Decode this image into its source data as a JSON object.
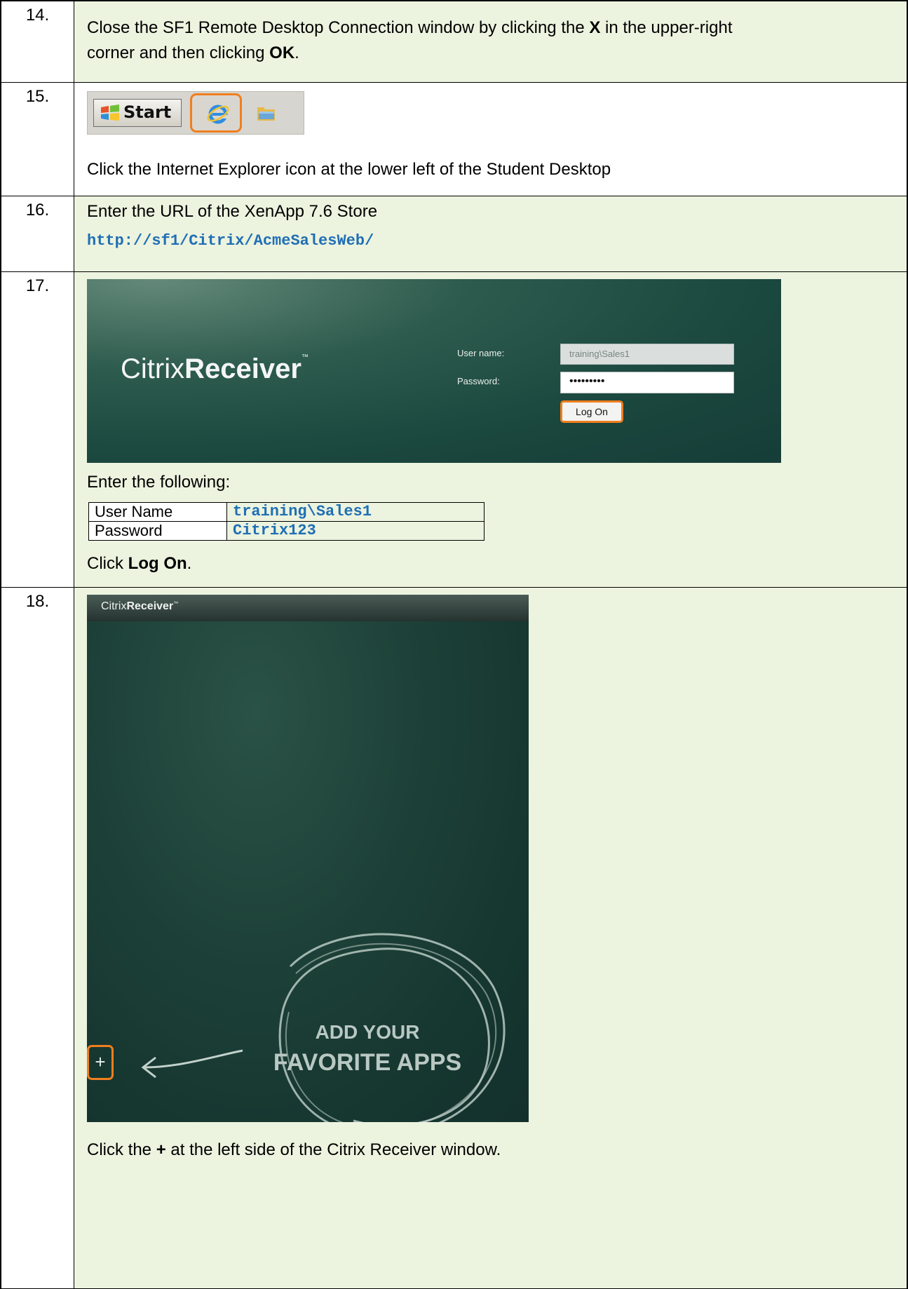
{
  "steps": [
    {
      "number": "14.",
      "text_parts": [
        "Close the SF1 Remote Desktop Connection window by clicking the ",
        "X",
        " in the upper-right",
        "corner and then clicking ",
        "OK",
        "."
      ]
    },
    {
      "number": "15.",
      "taskbar": {
        "start_label": "Start"
      },
      "text": "Click the Internet Explorer icon at the lower left of the Student Desktop"
    },
    {
      "number": "16.",
      "text": "Enter the URL of the XenApp 7.6 Store",
      "url": "http://sf1/Citrix/AcmeSalesWeb/"
    },
    {
      "number": "17.",
      "login": {
        "logo_prefix": "Citrix",
        "logo_name": "Receiver",
        "logo_tm": "™",
        "username_label": "User name:",
        "username_value": "training\\Sales1",
        "password_label": "Password:",
        "password_value": "•••••••••",
        "logon_button": "Log On"
      },
      "instruction": "Enter the following:",
      "credentials": [
        {
          "field": "User Name",
          "value": "training\\Sales1"
        },
        {
          "field": "Password",
          "value": "Citrix123"
        }
      ],
      "click_prefix": "Click ",
      "click_bold": "Log On",
      "click_suffix": "."
    },
    {
      "number": "18.",
      "receiver": {
        "logo_prefix": "Citrix",
        "logo_name": "Receiver",
        "logo_tm": "™",
        "line1": "ADD YOUR",
        "line2": "FAVORITE APPS",
        "plus": "+"
      },
      "text_prefix": "Click the ",
      "text_bold": "+",
      "text_suffix": " at the left side of the Citrix Receiver window."
    }
  ],
  "colors": {
    "cell_green": "#ecf3df",
    "highlight_orange": "#f07f1e",
    "code_blue": "#1f6fb4"
  }
}
